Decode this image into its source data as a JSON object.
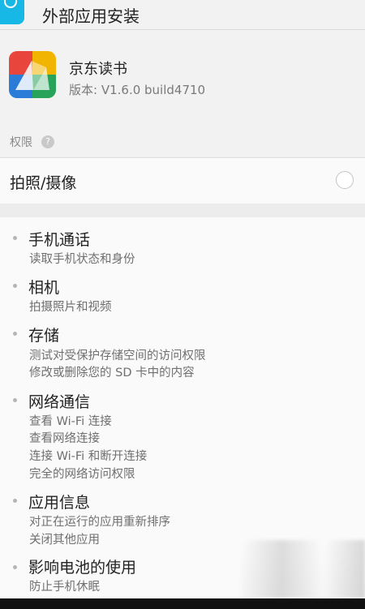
{
  "header": {
    "title": "外部应用安装"
  },
  "app": {
    "name": "京东读书",
    "version": "版本: V1.6.0 build4710"
  },
  "permissions_label": "权限",
  "help_symbol": "?",
  "camera_item": {
    "label": "拍照/摄像",
    "checked": false
  },
  "groups": [
    {
      "title": "手机通话",
      "items": [
        "读取手机状态和身份"
      ]
    },
    {
      "title": "相机",
      "items": [
        "拍摄照片和视频"
      ]
    },
    {
      "title": "存储",
      "items": [
        "测试对受保护存储空间的访问权限",
        "修改或删除您的 SD 卡中的内容"
      ]
    },
    {
      "title": "网络通信",
      "items": [
        "查看 Wi-Fi 连接",
        "查看网络连接",
        "连接 Wi-Fi 和断开连接",
        "完全的网络访问权限"
      ]
    },
    {
      "title": "应用信息",
      "items": [
        "对正在运行的应用重新排序",
        "关闭其他应用"
      ]
    },
    {
      "title": "影响电池的使用",
      "items": [
        "防止手机休眠"
      ]
    }
  ]
}
